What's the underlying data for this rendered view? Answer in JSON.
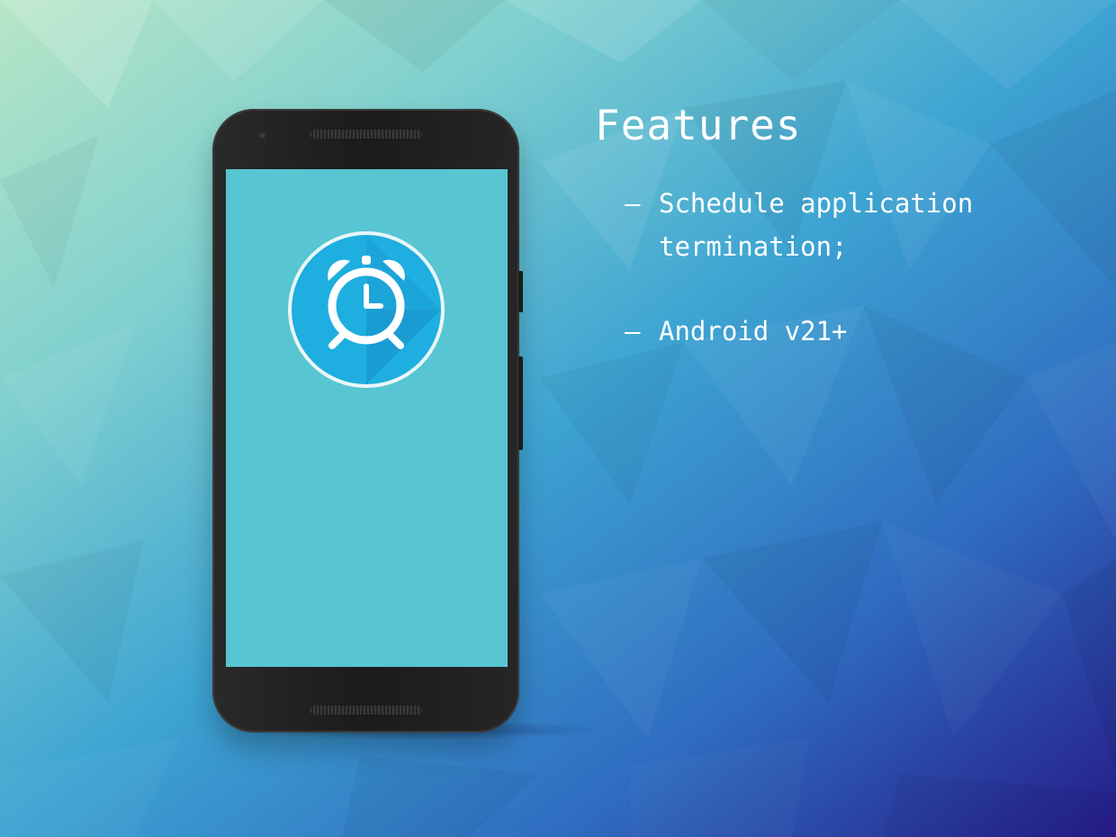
{
  "colors": {
    "background_top_left": "#a9dcc4",
    "background_mid": "#3f9fd0",
    "background_bottom_right": "#261f8a",
    "phone_body": "#1f1f1f",
    "screen": "#57c5d2",
    "icon_fill": "#1eaee0",
    "text": "#ffffff"
  },
  "heading": {
    "title": "Features"
  },
  "features": [
    {
      "dash": "–",
      "text": "Schedule application termination;"
    },
    {
      "dash": "–",
      "text": "Android v21+"
    }
  ],
  "icons": {
    "app_icon": "alarm-clock-icon"
  }
}
